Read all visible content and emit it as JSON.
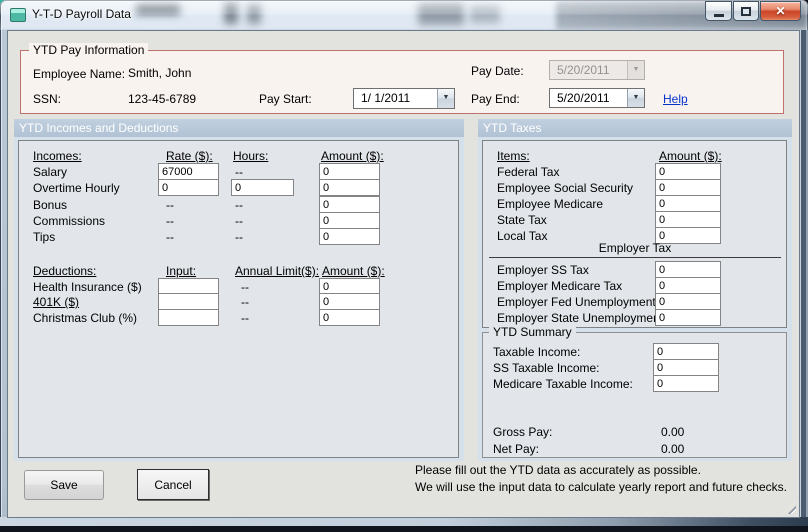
{
  "window": {
    "title": "Y-T-D Payroll Data"
  },
  "icons": {
    "close": "✕",
    "dropdown": "▼"
  },
  "colors": {
    "band": "#b6c5d7",
    "band_text": "#ffffff",
    "group_border": "#c1716b",
    "link": "#0633cc",
    "close_button": "#cb4527",
    "client_bg": "#e2e2df"
  },
  "pay_info": {
    "legend": "YTD Pay Information",
    "employee_name_label": "Employee Name:",
    "employee_name": "Smith, John",
    "ssn_label": "SSN:",
    "ssn": "123-45-6789",
    "pay_start_label": "Pay Start:",
    "pay_start": "1/ 1/2011",
    "pay_date_label": "Pay Date:",
    "pay_date": "5/20/2011",
    "pay_end_label": "Pay End:",
    "pay_end": "5/20/2011",
    "help_label": "Help"
  },
  "incomes_panel": {
    "title": "YTD Incomes and Deductions",
    "incomes_headers": {
      "col1": "Incomes:",
      "col2": "Rate ($):",
      "col3": "Hours:",
      "col4": "Amount ($):"
    },
    "incomes_rows": [
      {
        "label": "Salary",
        "rate": "67000",
        "hours": "--",
        "amount": "0"
      },
      {
        "label": "Overtime Hourly",
        "rate": "0",
        "hours": "0",
        "amount": "0"
      },
      {
        "label": "Bonus",
        "rate": "--",
        "hours": "--",
        "amount": "0"
      },
      {
        "label": "Commissions",
        "rate": "--",
        "hours": "--",
        "amount": "0"
      },
      {
        "label": "Tips",
        "rate": "--",
        "hours": "--",
        "amount": "0"
      }
    ],
    "deductions_headers": {
      "col1": "Deductions:",
      "col2": "Input:",
      "col3": "Annual Limit($):",
      "col4": "Amount ($):"
    },
    "deductions_rows": [
      {
        "label": "Health Insurance  ($)",
        "input": "",
        "limit": "--",
        "amount": "0"
      },
      {
        "label": "401K  ($)",
        "input": "",
        "limit": "--",
        "amount": "0"
      },
      {
        "label": "Christmas Club  (%)",
        "input": "",
        "limit": "--",
        "amount": "0"
      }
    ]
  },
  "taxes_panel": {
    "title": "YTD Taxes",
    "headers": {
      "col1": "Items:",
      "col2": "Amount ($):"
    },
    "employee_rows": [
      {
        "label": "Federal Tax",
        "value": "0"
      },
      {
        "label": "Employee Social Security",
        "value": "0"
      },
      {
        "label": "Employee Medicare",
        "value": "0"
      },
      {
        "label": "State Tax",
        "value": "0"
      },
      {
        "label": "Local Tax",
        "value": "0"
      }
    ],
    "employer_section_title": "Employer Tax",
    "employer_rows": [
      {
        "label": "Employer SS Tax",
        "value": "0"
      },
      {
        "label": "Employer Medicare Tax",
        "value": "0"
      },
      {
        "label": "Employer Fed Unemployment",
        "value": "0"
      },
      {
        "label": "Employer State Unemployment",
        "value": "0"
      }
    ]
  },
  "summary_panel": {
    "legend": "YTD Summary",
    "rows": [
      {
        "label": "Taxable Income:",
        "value": "0"
      },
      {
        "label": "SS Taxable Income:",
        "value": "0"
      },
      {
        "label": "Medicare Taxable Income:",
        "value": "0"
      }
    ],
    "gross_pay_label": "Gross Pay:",
    "gross_pay": "0.00",
    "net_pay_label": "Net Pay:",
    "net_pay": "0.00"
  },
  "footer": {
    "save_label": "Save",
    "cancel_label": "Cancel",
    "note_line1": "Please fill out the YTD data as accurately as possible.",
    "note_line2": "We will use the input data to calculate yearly report and future checks."
  }
}
